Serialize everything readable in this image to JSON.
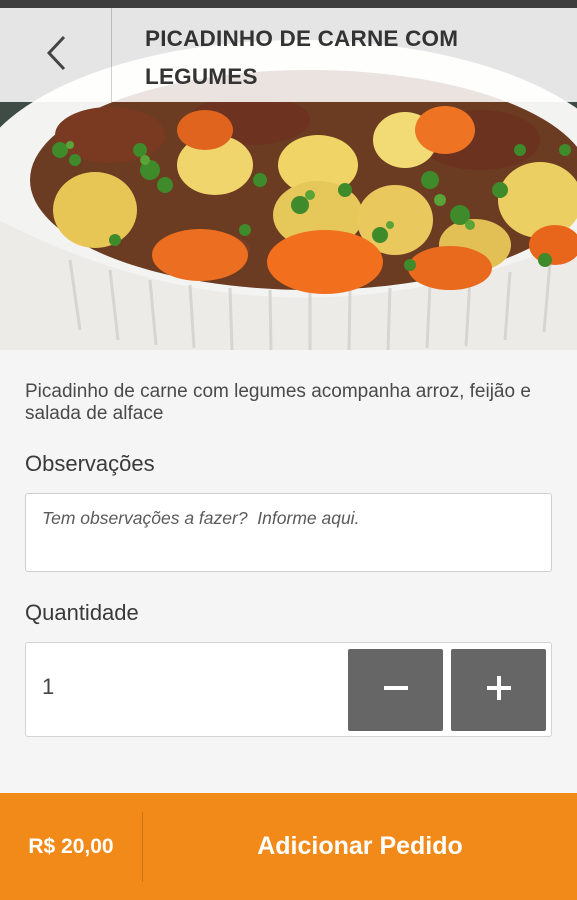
{
  "header": {
    "back_icon": "chevron-left-icon",
    "title": "PICADINHO DE CARNE COM LEGUMES"
  },
  "hero": {
    "image_subject": "beef stew with potatoes, carrots and parsley in a white bowl"
  },
  "product": {
    "description": "Picadinho de carne com legumes acompanha arroz, feijão e salada de alface"
  },
  "observations": {
    "label": "Observações",
    "value": "",
    "placeholder": "Tem observações a fazer?  Informe aqui."
  },
  "quantity": {
    "label": "Quantidade",
    "value": "1",
    "decrement_label": "−",
    "increment_label": "+"
  },
  "footer": {
    "price": "R$ 20,00",
    "add_button_label": "Adicionar Pedido"
  },
  "colors": {
    "accent": "#f18a18",
    "stepper_button": "#666666",
    "text": "#3a3a3a"
  }
}
